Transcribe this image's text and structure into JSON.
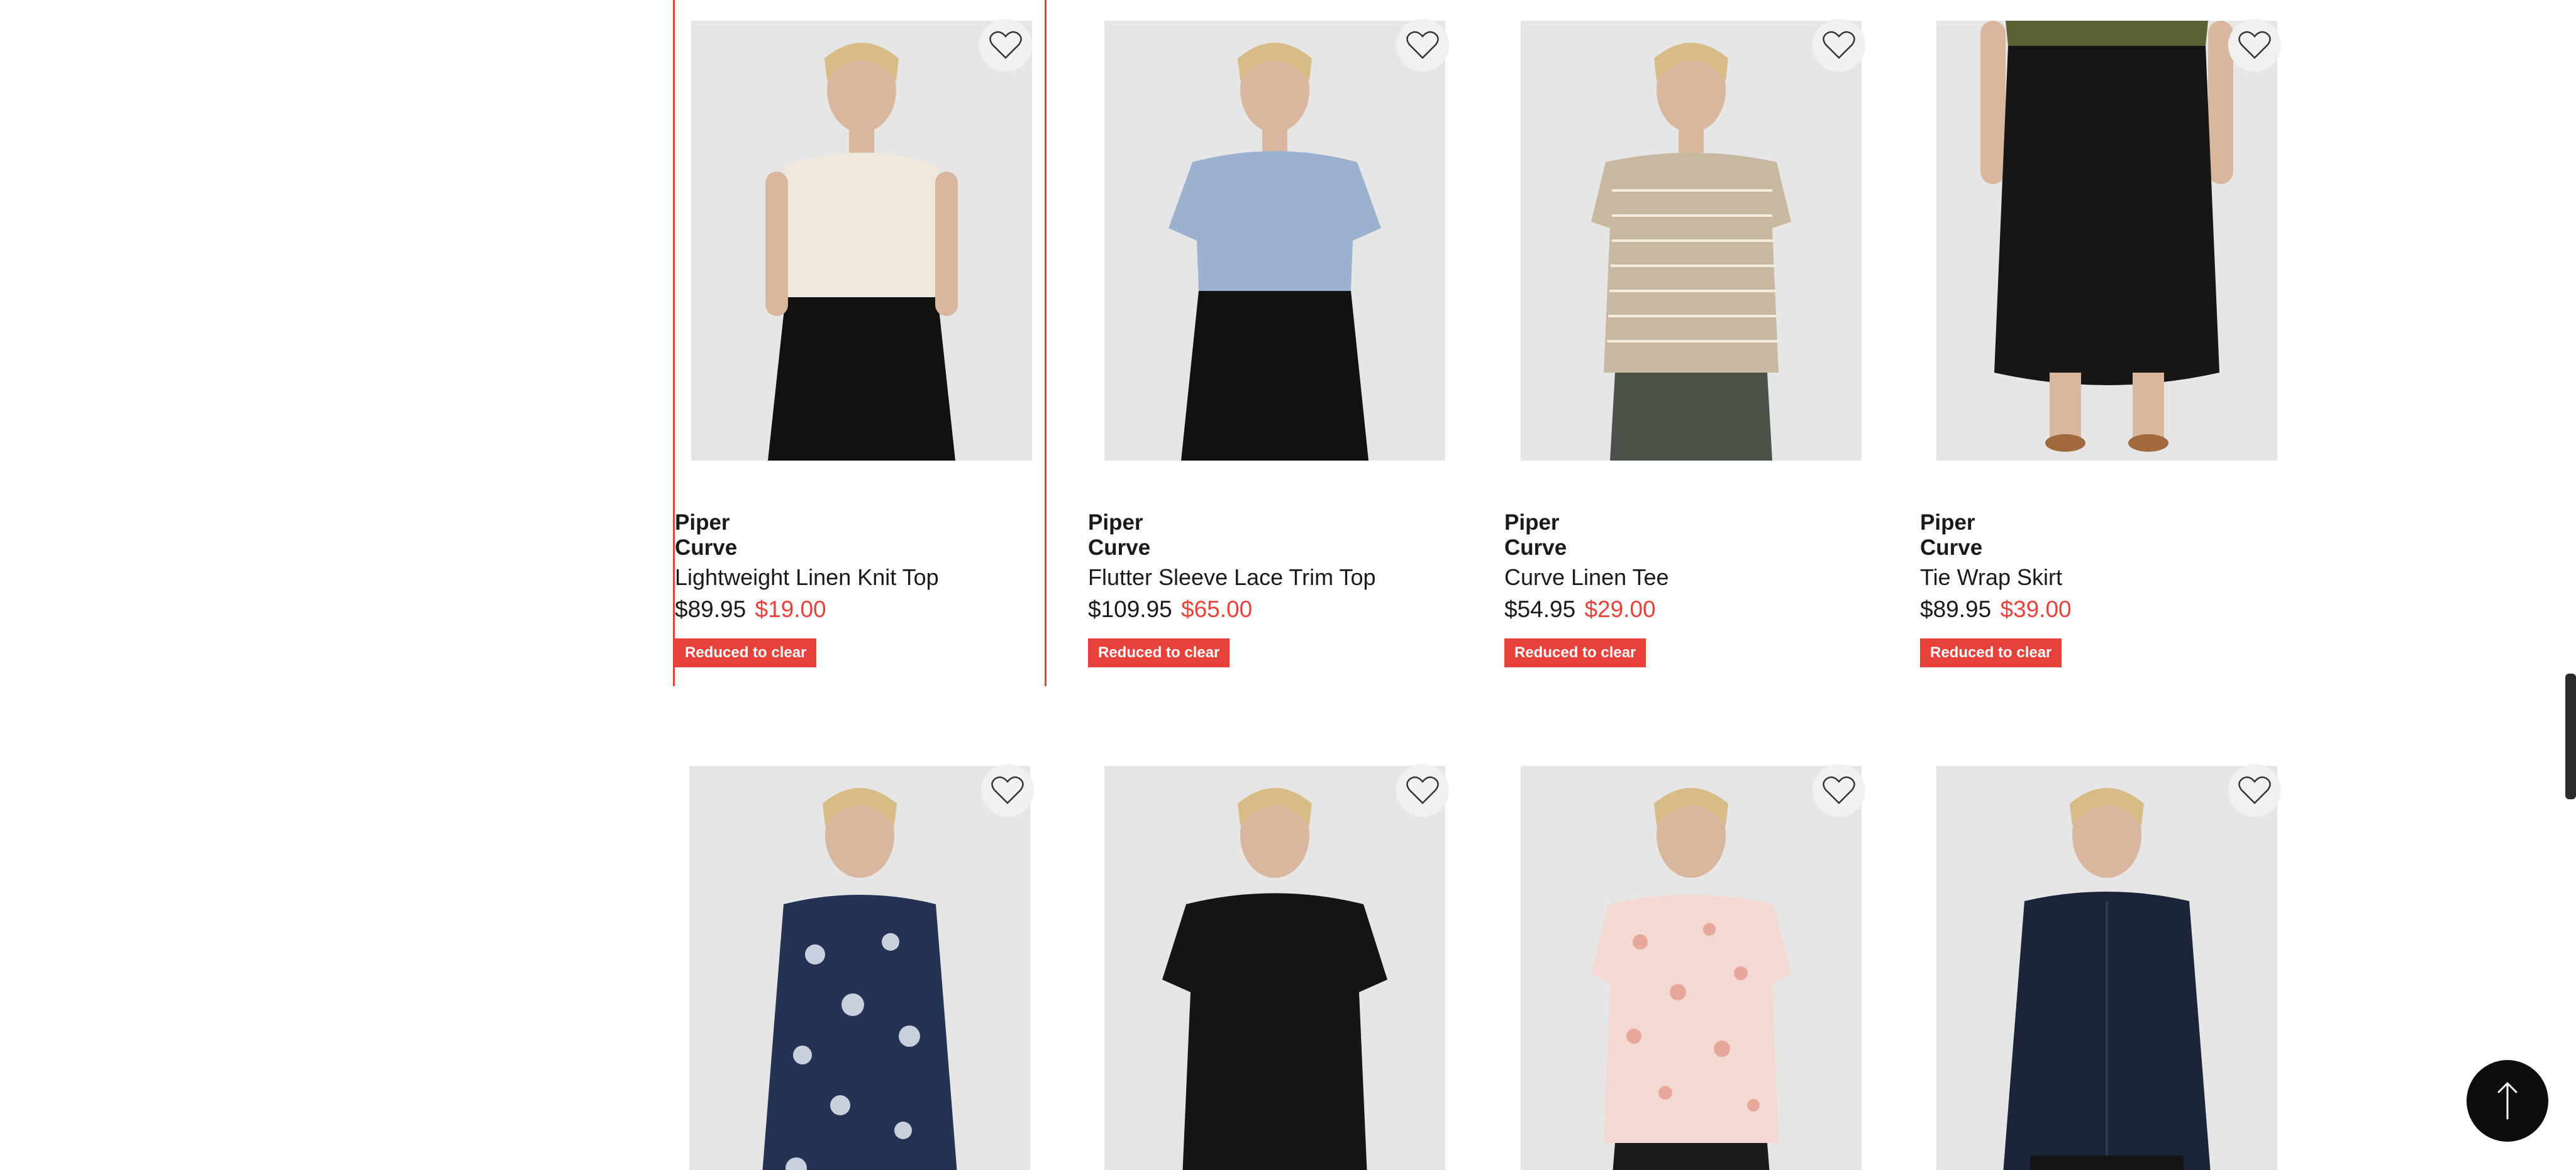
{
  "products": [
    {
      "brand": [
        "Piper",
        "Curve"
      ],
      "name": "Lightweight Linen Knit Top",
      "was": "$89.95",
      "now": "$19.00",
      "badge": "Reduced to clear",
      "top_color": "#efe9dc",
      "bottom_color": "#111111"
    },
    {
      "brand": [
        "Piper",
        "Curve"
      ],
      "name": "Flutter Sleeve Lace Trim Top",
      "was": "$109.95",
      "now": "$65.00",
      "badge": "Reduced to clear",
      "top_color": "#9ab2cf",
      "bottom_color": "#111111"
    },
    {
      "brand": [
        "Piper",
        "Curve"
      ],
      "name": "Curve Linen Tee",
      "was": "$54.95",
      "now": "$29.00",
      "badge": "Reduced to clear",
      "top_color": "#c8b8a0",
      "bottom_color": "#4b5248"
    },
    {
      "brand": [
        "Piper",
        "Curve"
      ],
      "name": "Tie Wrap Skirt",
      "was": "$89.95",
      "now": "$39.00",
      "badge": "Reduced to clear",
      "top_color": "#5c6134",
      "bottom_color": "#161616"
    },
    {
      "top_color": "#243353",
      "bottom_color": "#243353"
    },
    {
      "top_color": "#151515",
      "bottom_color": "#151515"
    },
    {
      "top_color": "#f3d9d2",
      "bottom_color": "#1b1b1b"
    },
    {
      "top_color": "#1c2439",
      "bottom_color": "#151515"
    }
  ],
  "icons": {
    "wishlist": "heart-outline-icon",
    "back_to_top": "arrow-up-icon"
  }
}
